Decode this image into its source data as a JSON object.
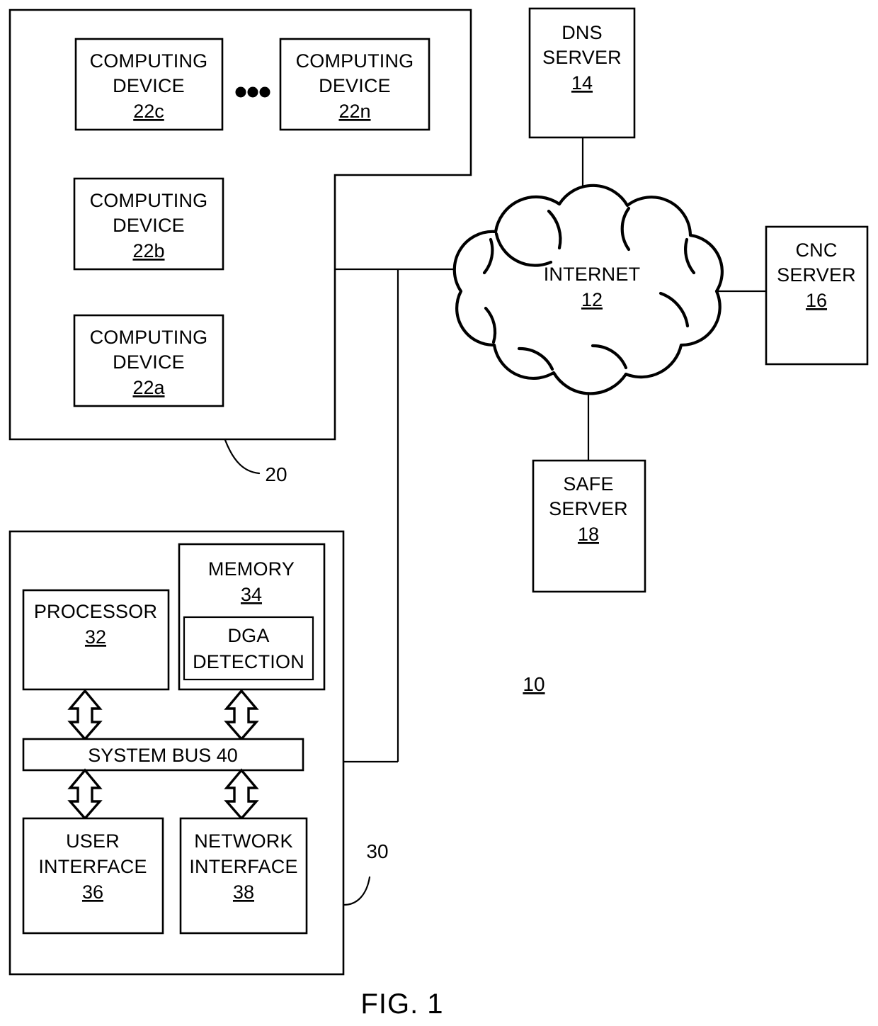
{
  "figure": {
    "caption": "FIG. 1",
    "system_ref": "10"
  },
  "network_group": {
    "ref_label": "20",
    "devices": [
      {
        "line1": "COMPUTING",
        "line2": "DEVICE",
        "ref": "22c"
      },
      {
        "line1": "COMPUTING",
        "line2": "DEVICE",
        "ref": "22n"
      },
      {
        "line1": "COMPUTING",
        "line2": "DEVICE",
        "ref": "22b"
      },
      {
        "line1": "COMPUTING",
        "line2": "DEVICE",
        "ref": "22a"
      }
    ],
    "ellipsis": "..."
  },
  "cloud": {
    "label": "INTERNET",
    "ref": "12"
  },
  "servers": [
    {
      "line1": "DNS",
      "line2": "SERVER",
      "ref": "14"
    },
    {
      "line1": "CNC",
      "line2": "SERVER",
      "ref": "16"
    },
    {
      "line1": "SAFE",
      "line2": "SERVER",
      "ref": "18"
    }
  ],
  "computer_system": {
    "ref_label": "30",
    "processor": {
      "label": "PROCESSOR",
      "ref": "32"
    },
    "memory": {
      "label": "MEMORY",
      "ref": "34"
    },
    "dga": {
      "line1": "DGA",
      "line2": "DETECTION"
    },
    "system_bus": {
      "label": "SYSTEM BUS 40"
    },
    "user_interface": {
      "line1": "USER",
      "line2": "INTERFACE",
      "ref": "36"
    },
    "network_interface": {
      "line1": "NETWORK",
      "line2": "INTERFACE",
      "ref": "38"
    }
  },
  "colors": {
    "stroke": "#000000",
    "fill": "#ffffff"
  }
}
